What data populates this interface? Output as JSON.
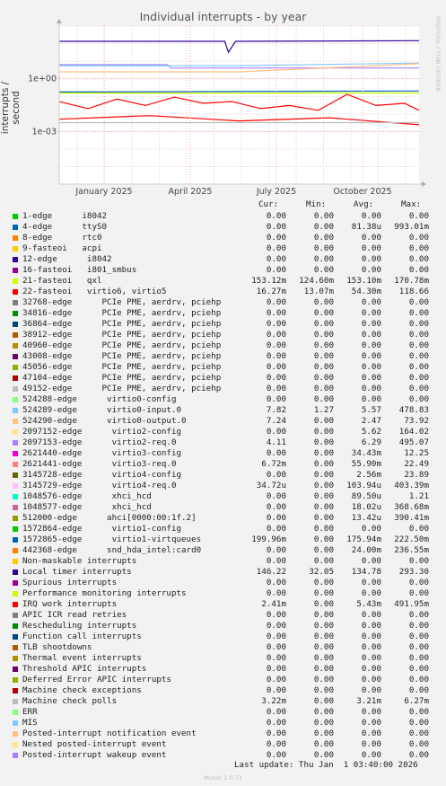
{
  "graph": {
    "title": "Individual interrupts - by year",
    "ylabel": "interrupts / second",
    "watermark": "RRDTOOL / TOBI OETIKER",
    "footer": "Munin 2.0.73",
    "last_update": "Last update: Thu Jan  1 03:40:00 2026"
  },
  "table_header": {
    "cur": "Cur:",
    "min": "Min:",
    "avg": "Avg:",
    "max": "Max:"
  },
  "legend": [
    {
      "label": "1-edge      i8042",
      "cur": "0.00",
      "min": "0.00",
      "avg": "0.00",
      "max": "0.00",
      "color": "#00cc00"
    },
    {
      "label": "4-edge      ttyS0",
      "cur": "0.00",
      "min": "0.00",
      "avg": "81.38u",
      "max": "993.01m",
      "color": "#0066b3"
    },
    {
      "label": "8-edge      rtc0",
      "cur": "0.00",
      "min": "0.00",
      "avg": "0.00",
      "max": "0.00",
      "color": "#ff8000"
    },
    {
      "label": "9-fasteoi   acpi",
      "cur": "0.00",
      "min": "0.00",
      "avg": "0.00",
      "max": "0.00",
      "color": "#ffcc00"
    },
    {
      "label": "12-edge      i8042",
      "cur": "0.00",
      "min": "0.00",
      "avg": "0.00",
      "max": "0.00",
      "color": "#330099"
    },
    {
      "label": "16-fasteoi   i801_smbus",
      "cur": "0.00",
      "min": "0.00",
      "avg": "0.00",
      "max": "0.00",
      "color": "#990099"
    },
    {
      "label": "21-fasteoi   qxl",
      "cur": "153.12m",
      "min": "124.60m",
      "avg": "153.10m",
      "max": "170.78m",
      "color": "#ccff00"
    },
    {
      "label": "22-fasteoi   virtio6, virtio5",
      "cur": "16.27m",
      "min": "13.07m",
      "avg": "54.30m",
      "max": "118.66",
      "color": "#ff0000"
    },
    {
      "label": "32768-edge      PCIe PME, aerdrv, pciehp",
      "cur": "0.00",
      "min": "0.00",
      "avg": "0.00",
      "max": "0.00",
      "color": "#808080"
    },
    {
      "label": "34816-edge      PCIe PME, aerdrv, pciehp",
      "cur": "0.00",
      "min": "0.00",
      "avg": "0.00",
      "max": "0.00",
      "color": "#008f00"
    },
    {
      "label": "36864-edge      PCIe PME, aerdrv, pciehp",
      "cur": "0.00",
      "min": "0.00",
      "avg": "0.00",
      "max": "0.00",
      "color": "#00487d"
    },
    {
      "label": "38912-edge      PCIe PME, aerdrv, pciehp",
      "cur": "0.00",
      "min": "0.00",
      "avg": "0.00",
      "max": "0.00",
      "color": "#b35a00"
    },
    {
      "label": "40960-edge      PCIe PME, aerdrv, pciehp",
      "cur": "0.00",
      "min": "0.00",
      "avg": "0.00",
      "max": "0.00",
      "color": "#b38f00"
    },
    {
      "label": "43008-edge      PCIe PME, aerdrv, pciehp",
      "cur": "0.00",
      "min": "0.00",
      "avg": "0.00",
      "max": "0.00",
      "color": "#6b006b"
    },
    {
      "label": "45056-edge      PCIe PME, aerdrv, pciehp",
      "cur": "0.00",
      "min": "0.00",
      "avg": "0.00",
      "max": "0.00",
      "color": "#8fb300"
    },
    {
      "label": "47104-edge      PCIe PME, aerdrv, pciehp",
      "cur": "0.00",
      "min": "0.00",
      "avg": "0.00",
      "max": "0.00",
      "color": "#b30000"
    },
    {
      "label": "49152-edge      PCIe PME, aerdrv, pciehp",
      "cur": "0.00",
      "min": "0.00",
      "avg": "0.00",
      "max": "0.00",
      "color": "#bebebe"
    },
    {
      "label": "524288-edge      virtio0-config",
      "cur": "0.00",
      "min": "0.00",
      "avg": "0.00",
      "max": "0.00",
      "color": "#80ff80"
    },
    {
      "label": "524289-edge      virtio0-input.0",
      "cur": "7.82",
      "min": "1.27",
      "avg": "5.57",
      "max": "478.83",
      "color": "#80c9ff"
    },
    {
      "label": "524290-edge      virtio0-output.0",
      "cur": "7.24",
      "min": "0.00",
      "avg": "2.47",
      "max": "73.92",
      "color": "#ffc080"
    },
    {
      "label": "2097152-edge      virtio2-config",
      "cur": "0.00",
      "min": "0.00",
      "avg": "5.62",
      "max": "164.02",
      "color": "#ffe680"
    },
    {
      "label": "2097153-edge      virtio2-req.0",
      "cur": "4.11",
      "min": "0.00",
      "avg": "6.29",
      "max": "495.07",
      "color": "#aa80ff"
    },
    {
      "label": "2621440-edge      virtio3-config",
      "cur": "0.00",
      "min": "0.00",
      "avg": "34.43m",
      "max": "12.25",
      "color": "#ee00cc"
    },
    {
      "label": "2621441-edge      virtio3-req.0",
      "cur": "6.72m",
      "min": "0.00",
      "avg": "55.90m",
      "max": "22.49",
      "color": "#ff8080"
    },
    {
      "label": "3145728-edge      virtio4-config",
      "cur": "0.00",
      "min": "0.00",
      "avg": "2.56m",
      "max": "23.89",
      "color": "#666600"
    },
    {
      "label": "3145729-edge      virtio4-req.0",
      "cur": "34.72u",
      "min": "0.00",
      "avg": "103.94u",
      "max": "403.39m",
      "color": "#ffbfff"
    },
    {
      "label": "1048576-edge      xhci_hcd",
      "cur": "0.00",
      "min": "0.00",
      "avg": "89.50u",
      "max": "1.21",
      "color": "#00ffcc"
    },
    {
      "label": "1048577-edge      xhci_hcd",
      "cur": "0.00",
      "min": "0.00",
      "avg": "18.02u",
      "max": "368.68m",
      "color": "#cc6699"
    },
    {
      "label": "512000-edge      ahci[0000:00:1f.2]",
      "cur": "0.00",
      "min": "0.00",
      "avg": "13.42u",
      "max": "390.41m",
      "color": "#999900"
    },
    {
      "label": "1572864-edge      virtio1-config",
      "cur": "0.00",
      "min": "0.00",
      "avg": "0.00",
      "max": "0.00",
      "color": "#00cc00"
    },
    {
      "label": "1572865-edge      virtio1-virtqueues",
      "cur": "199.96m",
      "min": "0.00",
      "avg": "175.94m",
      "max": "222.50m",
      "color": "#0066b3"
    },
    {
      "label": "442368-edge      snd_hda_intel:card0",
      "cur": "0.00",
      "min": "0.00",
      "avg": "24.00m",
      "max": "236.55m",
      "color": "#ff8000"
    },
    {
      "label": "Non-maskable interrupts",
      "cur": "0.00",
      "min": "0.00",
      "avg": "0.00",
      "max": "0.00",
      "color": "#ffcc00"
    },
    {
      "label": "Local timer interrupts",
      "cur": "146.22",
      "min": "32.05",
      "avg": "134.78",
      "max": "293.30",
      "color": "#330099"
    },
    {
      "label": "Spurious interrupts",
      "cur": "0.00",
      "min": "0.00",
      "avg": "0.00",
      "max": "0.00",
      "color": "#990099"
    },
    {
      "label": "Performance monitoring interrupts",
      "cur": "0.00",
      "min": "0.00",
      "avg": "0.00",
      "max": "0.00",
      "color": "#ccff00"
    },
    {
      "label": "IRQ work interrupts",
      "cur": "2.41m",
      "min": "0.00",
      "avg": "5.43m",
      "max": "491.95m",
      "color": "#ff0000"
    },
    {
      "label": "APIC ICR read retries",
      "cur": "0.00",
      "min": "0.00",
      "avg": "0.00",
      "max": "0.00",
      "color": "#808080"
    },
    {
      "label": "Rescheduling interrupts",
      "cur": "0.00",
      "min": "0.00",
      "avg": "0.00",
      "max": "0.00",
      "color": "#008f00"
    },
    {
      "label": "Function call interrupts",
      "cur": "0.00",
      "min": "0.00",
      "avg": "0.00",
      "max": "0.00",
      "color": "#00487d"
    },
    {
      "label": "TLB shootdowns",
      "cur": "0.00",
      "min": "0.00",
      "avg": "0.00",
      "max": "0.00",
      "color": "#b35a00"
    },
    {
      "label": "Thermal event interrupts",
      "cur": "0.00",
      "min": "0.00",
      "avg": "0.00",
      "max": "0.00",
      "color": "#b38f00"
    },
    {
      "label": "Threshold APIC interrupts",
      "cur": "0.00",
      "min": "0.00",
      "avg": "0.00",
      "max": "0.00",
      "color": "#6b006b"
    },
    {
      "label": "Deferred Error APIC interrupts",
      "cur": "0.00",
      "min": "0.00",
      "avg": "0.00",
      "max": "0.00",
      "color": "#8fb300"
    },
    {
      "label": "Machine check exceptions",
      "cur": "0.00",
      "min": "0.00",
      "avg": "0.00",
      "max": "0.00",
      "color": "#b30000"
    },
    {
      "label": "Machine check polls",
      "cur": "3.22m",
      "min": "0.00",
      "avg": "3.21m",
      "max": "6.27m",
      "color": "#bebebe"
    },
    {
      "label": "ERR",
      "cur": "0.00",
      "min": "0.00",
      "avg": "0.00",
      "max": "0.00",
      "color": "#80ff80"
    },
    {
      "label": "MIS",
      "cur": "0.00",
      "min": "0.00",
      "avg": "0.00",
      "max": "0.00",
      "color": "#80c9ff"
    },
    {
      "label": "Posted-interrupt notification event",
      "cur": "0.00",
      "min": "0.00",
      "avg": "0.00",
      "max": "0.00",
      "color": "#ffc080"
    },
    {
      "label": "Nested posted-interrupt event",
      "cur": "0.00",
      "min": "0.00",
      "avg": "0.00",
      "max": "0.00",
      "color": "#ffe680"
    },
    {
      "label": "Posted-interrupt wakeup event",
      "cur": "0.00",
      "min": "0.00",
      "avg": "0.00",
      "max": "0.00",
      "color": "#aa80ff"
    }
  ],
  "chart_data": {
    "type": "line",
    "title": "Individual interrupts - by year",
    "ylabel": "interrupts / second",
    "yscale": "log",
    "ytick_labels": [
      "1e+00",
      "1e-03"
    ],
    "ytick_values": [
      1,
      0.001
    ],
    "xtick_labels": [
      "January 2025",
      "April 2025",
      "July 2025",
      "October 2025"
    ],
    "ylim": [
      1e-06,
      1000
    ],
    "grid": true,
    "series": [
      {
        "name": "Local timer interrupts",
        "color": "#330099",
        "x": [
          0,
          0.46,
          0.47,
          0.49,
          1
        ],
        "values": [
          134.78,
          134.78,
          32.05,
          134.78,
          146.22
        ]
      },
      {
        "name": "2097153-edge      virtio2-req.0",
        "color": "#aa80ff",
        "x": [
          0,
          0.3,
          0.31,
          1
        ],
        "values": [
          6.29,
          6.29,
          4.11,
          4.11
        ]
      },
      {
        "name": "524289-edge      virtio0-input.0",
        "color": "#80c9ff",
        "x": [
          0,
          0.5,
          1
        ],
        "values": [
          5.57,
          5.57,
          7.82
        ]
      },
      {
        "name": "524290-edge      virtio0-output.0",
        "color": "#ffc080",
        "x": [
          0,
          0.5,
          1
        ],
        "values": [
          2.47,
          2.47,
          7.24
        ]
      },
      {
        "name": "1572865-edge      virtio1-virtqueues",
        "color": "#0066b3",
        "x": [
          0,
          1
        ],
        "values": [
          0.176,
          0.2
        ]
      },
      {
        "name": "21-fasteoi   qxl",
        "color": "#ccff00",
        "x": [
          0,
          1
        ],
        "values": [
          0.153,
          0.153
        ]
      },
      {
        "name": "22-fasteoi   virtio6, virtio5",
        "color": "#ff0000",
        "x": [
          0,
          0.08,
          0.16,
          0.24,
          0.32,
          0.4,
          0.48,
          0.56,
          0.64,
          0.72,
          0.8,
          0.88,
          0.96,
          1
        ],
        "values": [
          0.05,
          0.02,
          0.07,
          0.03,
          0.09,
          0.04,
          0.05,
          0.02,
          0.03,
          0.016,
          0.13,
          0.03,
          0.04,
          0.016
        ]
      },
      {
        "name": "IRQ work interrupts",
        "color": "#ff0000",
        "x": [
          0,
          0.25,
          0.5,
          0.75,
          1
        ],
        "values": [
          0.005,
          0.008,
          0.004,
          0.006,
          0.0024
        ]
      },
      {
        "name": "Machine check polls",
        "color": "#bebebe",
        "x": [
          0,
          1
        ],
        "values": [
          0.0032,
          0.0032
        ]
      }
    ]
  }
}
